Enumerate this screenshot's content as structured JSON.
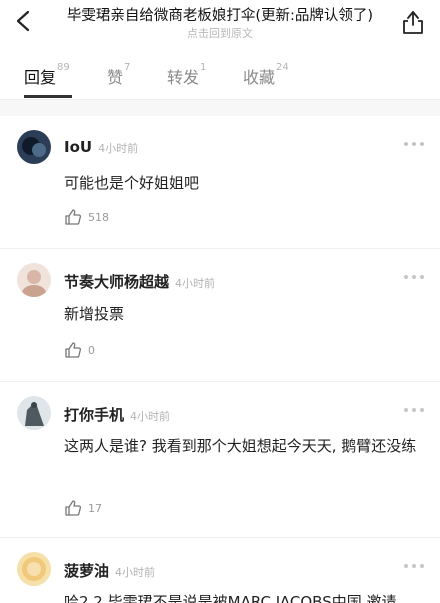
{
  "header": {
    "title": "毕雯珺亲自给微商老板娘打伞(更新:品牌认领了)",
    "subtitle": "点击回到原文",
    "back_icon": "chevron-left-icon",
    "share_icon": "share-icon"
  },
  "tabs": [
    {
      "label": "回复",
      "count": "89",
      "active": true
    },
    {
      "label": "赞",
      "count": "7",
      "active": false
    },
    {
      "label": "转发",
      "count": "1",
      "active": false
    },
    {
      "label": "收藏",
      "count": "24",
      "active": false
    }
  ],
  "comments": [
    {
      "name": "IoU",
      "time": "4小时前",
      "text": "可能也是个好姐姐吧",
      "likes": "518"
    },
    {
      "name": "节奏大师杨超越",
      "time": "4小时前",
      "text": "新增投票",
      "likes": "0"
    },
    {
      "name": "打你手机",
      "time": "4小时前",
      "text": "这两人是谁? 我看到那个大姐想起今天天, 鹅臂还没练",
      "likes": "17"
    },
    {
      "name": "菠萝油",
      "time": "4小时前",
      "text": "哈2 2 毕雯珺不是说是被MARC JACOBS中国 邀请"
    }
  ]
}
